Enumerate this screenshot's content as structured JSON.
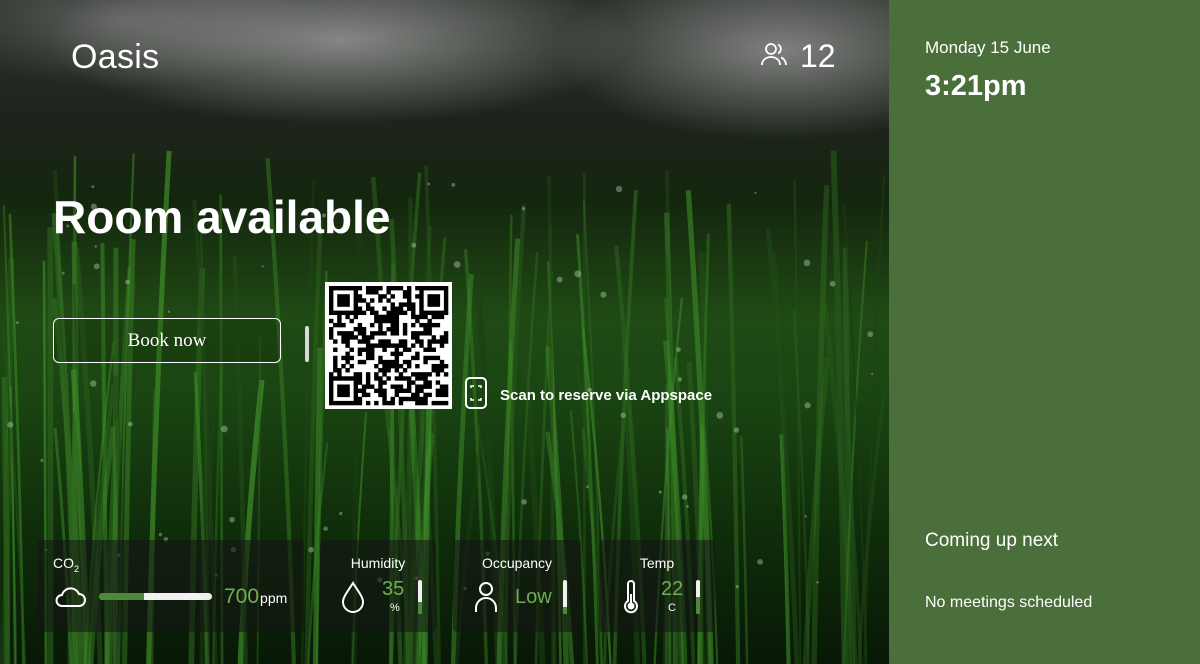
{
  "room": {
    "name": "Oasis",
    "capacity": "12"
  },
  "status": {
    "title": "Room available"
  },
  "actions": {
    "book_label": "Book now",
    "scan_label": "Scan to reserve via Appspace"
  },
  "sensors": {
    "co2": {
      "label_main": "CO",
      "label_sub": "2",
      "value": "700",
      "unit": "ppm",
      "level": 0.4
    },
    "humidity": {
      "label": "Humidity",
      "value": "35",
      "unit": "%",
      "level": 0.35
    },
    "occupancy": {
      "label": "Occupancy",
      "value": "Low",
      "level": 0.2
    },
    "temp": {
      "label": "Temp",
      "value": "22",
      "unit": "C",
      "level": 0.5
    }
  },
  "schedule": {
    "date": "Monday 15 June",
    "time": "3:21pm",
    "next_heading": "Coming up next",
    "next_text": "No meetings scheduled"
  },
  "colors": {
    "accent": "#6fae52",
    "panel": "#4b6f3a",
    "bar_fill": "#4a8a38"
  },
  "icons": [
    "people-icon",
    "phone-scan-icon",
    "cloud-icon",
    "droplet-icon",
    "person-icon",
    "thermometer-icon"
  ]
}
